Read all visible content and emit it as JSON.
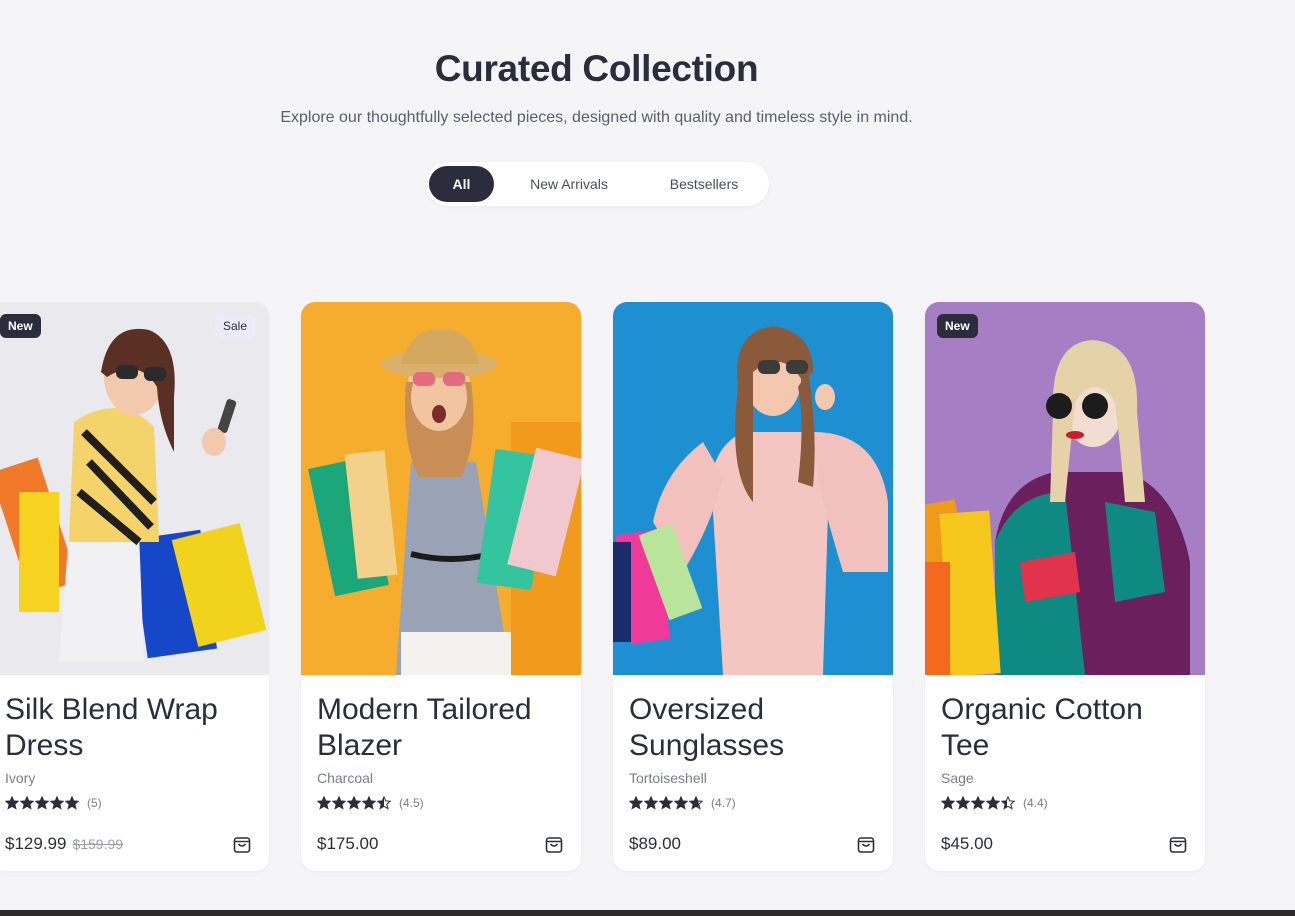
{
  "header": {
    "title": "Curated Collection",
    "subtitle": "Explore our thoughtfully selected pieces, designed with quality and timeless style in mind."
  },
  "filters": {
    "tabs": [
      {
        "label": "All",
        "active": true
      },
      {
        "label": "New Arrivals",
        "active": false
      },
      {
        "label": "Bestsellers",
        "active": false
      }
    ]
  },
  "products": [
    {
      "name": "Silk Blend Wrap Dress",
      "color": "Ivory",
      "rating": 5,
      "rating_label": "(5)",
      "price": "$129.99",
      "original_price": "$159.99",
      "badges": [
        "New",
        "Sale"
      ],
      "image_bg": "#e9e9ee"
    },
    {
      "name": "Modern Tailored Blazer",
      "color": "Charcoal",
      "rating": 4.5,
      "rating_label": "(4.5)",
      "price": "$175.00",
      "original_price": "",
      "badges": [],
      "image_bg": "#f7a92a"
    },
    {
      "name": "Oversized Sunglasses",
      "color": "Tortoiseshell",
      "rating": 4.7,
      "rating_label": "(4.7)",
      "price": "$89.00",
      "original_price": "",
      "badges": [],
      "image_bg": "#1a8fd1"
    },
    {
      "name": "Organic Cotton Tee",
      "color": "Sage",
      "rating": 4.4,
      "rating_label": "(4.4)",
      "price": "$45.00",
      "original_price": "",
      "badges": [
        "New"
      ],
      "image_bg": "#a77bc2"
    }
  ],
  "icons": {
    "cart": "shopping-bag-icon",
    "star": "star-icon"
  },
  "colors": {
    "primary": "#2b2d3d",
    "background": "#f5f5f8",
    "star": "#2b2d3d"
  }
}
